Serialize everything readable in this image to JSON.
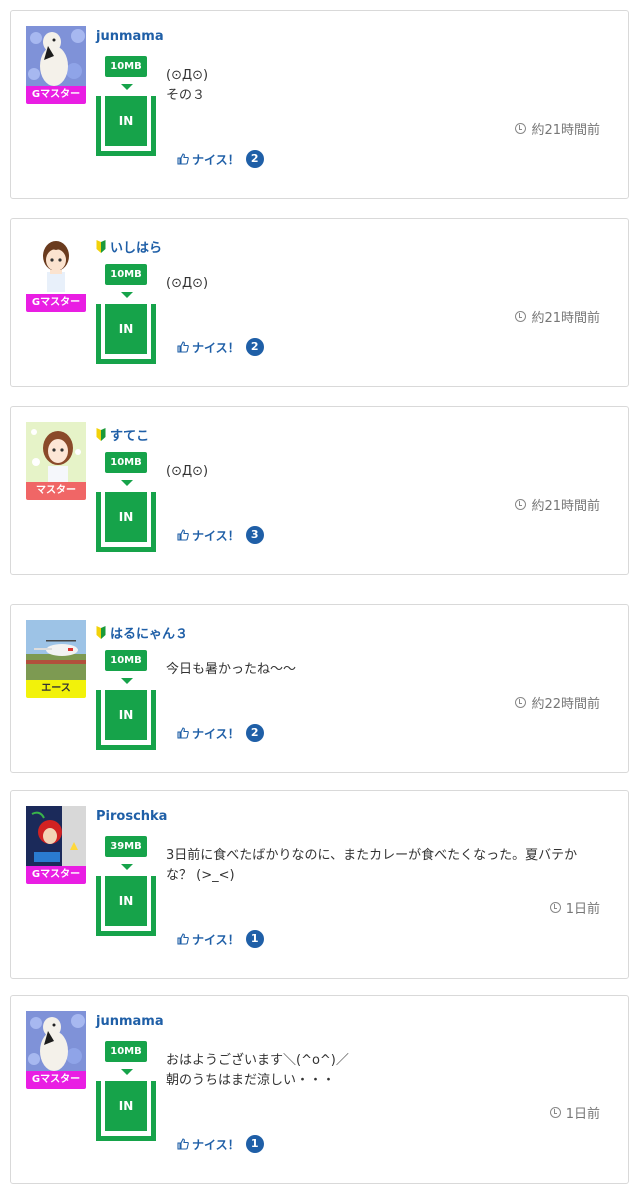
{
  "colors": {
    "accent_blue": "#1f5fa7",
    "green": "#16a34a",
    "rank_g_master": "#e91ee3",
    "rank_master": "#f06666",
    "rank_ace": "#f2f20a"
  },
  "icons": {
    "clock": "clock-icon",
    "thumb": "thumbs-up-icon",
    "beginner": "beginner-mark-icon"
  },
  "posts": [
    {
      "username": "junmama",
      "rank": "Gマスター",
      "size": "10MB",
      "in_label": "IN",
      "message": "(⊙Д⊙)\nその３",
      "time": "約21時間前",
      "nice_label": "ナイス！",
      "nice_count": "2"
    },
    {
      "username": "いしはら",
      "rank": "Gマスター",
      "size": "10MB",
      "in_label": "IN",
      "message": "(⊙Д⊙)",
      "time": "約21時間前",
      "nice_label": "ナイス！",
      "nice_count": "2"
    },
    {
      "username": "すてこ",
      "rank": "マスター",
      "size": "10MB",
      "in_label": "IN",
      "message": "(⊙Д⊙)",
      "time": "約21時間前",
      "nice_label": "ナイス！",
      "nice_count": "3"
    },
    {
      "username": "はるにゃん３",
      "rank": "エース",
      "size": "10MB",
      "in_label": "IN",
      "message": "今日も暑かったね〜〜",
      "time": "約22時間前",
      "nice_label": "ナイス！",
      "nice_count": "2"
    },
    {
      "username": "Piroschka",
      "rank": "Gマスター",
      "size": "39MB",
      "in_label": "IN",
      "message": "3日前に食べたばかりなのに、またカレーが食べたくなった。夏バテかな？ (>_<)",
      "time": "1日前",
      "nice_label": "ナイス！",
      "nice_count": "1"
    },
    {
      "username": "junmama",
      "rank": "Gマスター",
      "size": "10MB",
      "in_label": "IN",
      "message": "おはようございます＼(^o^)／\n朝のうちはまだ涼しい・・・",
      "time": "1日前",
      "nice_label": "ナイス！",
      "nice_count": "1"
    }
  ]
}
